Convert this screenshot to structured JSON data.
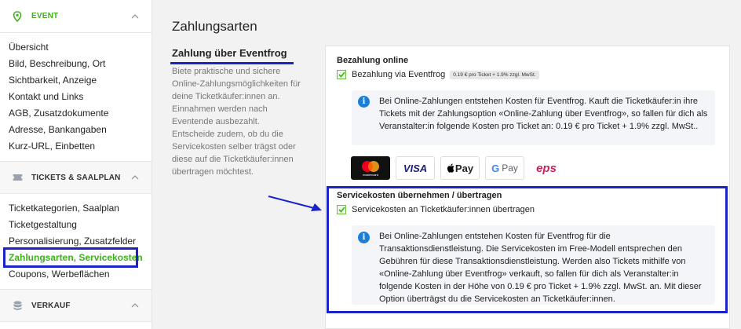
{
  "sidebar": {
    "event_title": "EVENT",
    "event_items": [
      "Übersicht",
      "Bild, Beschreibung, Ort",
      "Sichtbarkeit, Anzeige",
      "Kontakt und Links",
      "AGB, Zusatzdokumente",
      "Adresse, Bankangaben",
      "Kurz-URL, Einbetten"
    ],
    "tickets_title": "TICKETS & SAALPLAN",
    "ticket_items": [
      "Ticketkategorien, Saalplan",
      "Ticketgestaltung",
      "Personalisierung, Zusatzfelder",
      "Zahlungsarten, Servicekosten",
      "Coupons, Werbeflächen"
    ],
    "verkauf_title": "VERKAUF"
  },
  "main": {
    "page_title": "Zahlungsarten",
    "section_title": "Zahlung über Eventfrog",
    "section_desc": "Biete praktische und sichere Online-Zahlungsmöglichkeiten für deine Ticketkäufer:innen an. Einnahmen werden nach Eventende ausbezahlt. Entscheide zudem, ob du die Servicekosten selber trägst oder diese auf die Ticketkäufer:innen übertragen möchtest.",
    "online_label": "Bezahlung online",
    "online_checkbox": "Bezahlung via Eventfrog",
    "price_badge": "0.19 € pro Ticket + 1.9% zzgl. MwSt.",
    "online_info": "Bei Online-Zahlungen entstehen Kosten für Eventfrog. Kauft die Ticketkäufer:in ihre Tickets mit der Zahlungsoption «Online-Zahlung über Eventfrog», so fallen für dich als Veranstalter:in folgende Kosten pro Ticket an: 0.19 € pro Ticket + 1.9% zzgl. MwSt..",
    "logos": {
      "mastercard": "mastercard",
      "visa": "VISA",
      "applepay": "Pay",
      "googlepay": "Pay",
      "eps": "eps"
    },
    "service_label": "Servicekosten übernehmen / übertragen",
    "service_checkbox": "Servicekosten an Ticketkäufer:innen übertragen",
    "service_info": "Bei Online-Zahlungen entstehen Kosten für Eventfrog für die Transaktionsdienstleistung. Die Servicekosten im Free-Modell entsprechen den Gebühren für diese Transaktionsdienstleistung. Werden also Tickets mithilfe von «Online-Zahlung über Eventfrog» verkauft, so fallen für dich als Veranstalter:in folgende Kosten in der Höhe von 0.19 € pro Ticket + 1.9% zzgl. MwSt. an. Mit dieser Option überträgst du die Servicekosten an Ticketkäufer:innen."
  },
  "colors": {
    "accent_green": "#3fb01d",
    "annotation_blue": "#1a23c9",
    "info_blue": "#1a7fd8"
  }
}
